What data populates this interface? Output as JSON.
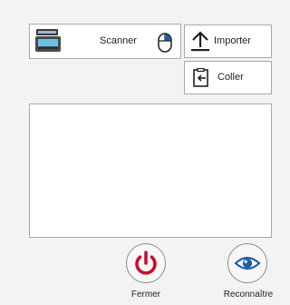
{
  "toolbar": {
    "scanner_label": "Scanner",
    "importer_label": "Importer",
    "coller_label": "Coller"
  },
  "icons": {
    "scanner": "scanner-icon",
    "mouse": "mouse-icon",
    "importer": "upload-icon",
    "coller": "paste-icon",
    "fermer": "power-icon",
    "reconnaitre": "eye-icon"
  },
  "actions": {
    "fermer_label": "Fermer",
    "reconnaitre_label": "Reconnaître"
  },
  "colors": {
    "power_red": "#c8102e",
    "eye_blue": "#1f5fa8",
    "icon_dark": "#1f1f1f"
  }
}
